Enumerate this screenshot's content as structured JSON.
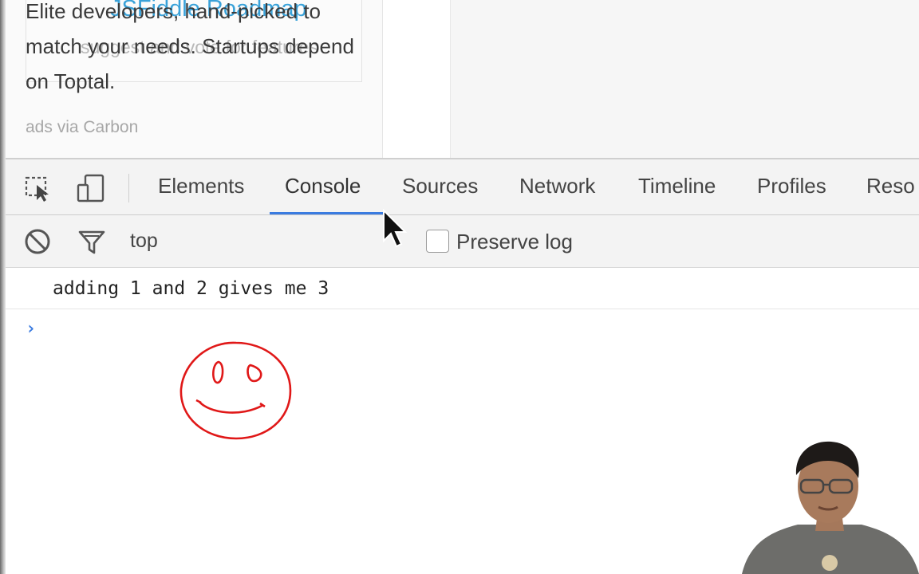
{
  "webpage": {
    "roadmap_title": "JSFiddle Roadmap",
    "roadmap_subtitle": "suggest and vote for features",
    "ad_text": "Elite developers, hand-picked to match your needs. Startups depend on Toptal.",
    "ad_via": "ads via Carbon"
  },
  "devtools": {
    "tabs": [
      {
        "label": "Elements"
      },
      {
        "label": "Console"
      },
      {
        "label": "Sources"
      },
      {
        "label": "Network"
      },
      {
        "label": "Timeline"
      },
      {
        "label": "Profiles"
      },
      {
        "label": "Reso"
      }
    ],
    "active_tab": "Console",
    "icons": {
      "inspect": "inspect-element-icon",
      "device": "device-mode-icon",
      "clear": "clear-console-icon",
      "filter": "filter-icon",
      "prompt": "chevron-right-icon"
    },
    "toolbar": {
      "context": "top",
      "preserve_log_label": "Preserve log",
      "preserve_log_checked": false
    },
    "console": {
      "lines": [
        "adding 1 and 2 gives me 3"
      ],
      "prompt_symbol": "›"
    },
    "colors": {
      "accent": "#3a7be0",
      "annotation": "#e01818"
    }
  }
}
